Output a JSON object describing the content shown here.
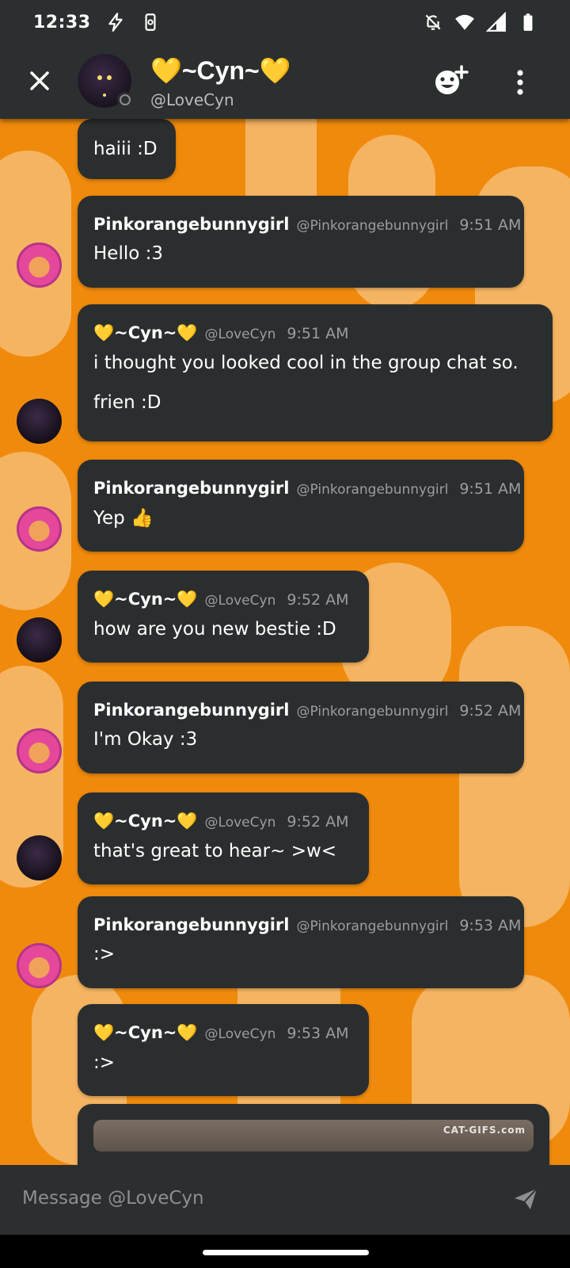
{
  "status_bar": {
    "time": "12:33"
  },
  "header": {
    "name": "💛~Cyn~💛",
    "handle": "@LoveCyn"
  },
  "messages": [
    {
      "text": "haiii :D"
    },
    {
      "author": "Pinkorangebunnygirl",
      "handle": "@Pinkorangebunnygirl",
      "time": "9:51 AM",
      "text": "Hello :3"
    },
    {
      "author": "💛~Cyn~💛",
      "handle": "@LoveCyn",
      "time": "9:51 AM",
      "text": "i thought you looked cool in the group chat so.",
      "text2": "frien :D"
    },
    {
      "author": "Pinkorangebunnygirl",
      "handle": "@Pinkorangebunnygirl",
      "time": "9:51 AM",
      "text": "Yep 👍"
    },
    {
      "author": "💛~Cyn~💛",
      "handle": "@LoveCyn",
      "time": "9:52 AM",
      "text": "how are you new bestie :D"
    },
    {
      "author": "Pinkorangebunnygirl",
      "handle": "@Pinkorangebunnygirl",
      "time": "9:52 AM",
      "text": "I'm Okay :3"
    },
    {
      "author": "💛~Cyn~💛",
      "handle": "@LoveCyn",
      "time": "9:52 AM",
      "text": "that's great to hear~ >w<"
    },
    {
      "author": "Pinkorangebunnygirl",
      "handle": "@Pinkorangebunnygirl",
      "time": "9:53 AM",
      "text": ":>"
    },
    {
      "author": "💛~Cyn~💛",
      "handle": "@LoveCyn",
      "time": "9:53 AM",
      "text": ":>"
    },
    {
      "gif_label": "CAT-GIFS.com"
    }
  ],
  "composer": {
    "placeholder": "Message @LoveCyn"
  },
  "icons": {
    "close": "close-icon",
    "add_friend": "add-friend-icon",
    "more": "more-vertical-icon",
    "send": "send-icon"
  },
  "colors": {
    "chat_background": "#f08a0c",
    "bubble": "#2b2e2f",
    "bars": "#2c2f2f"
  }
}
